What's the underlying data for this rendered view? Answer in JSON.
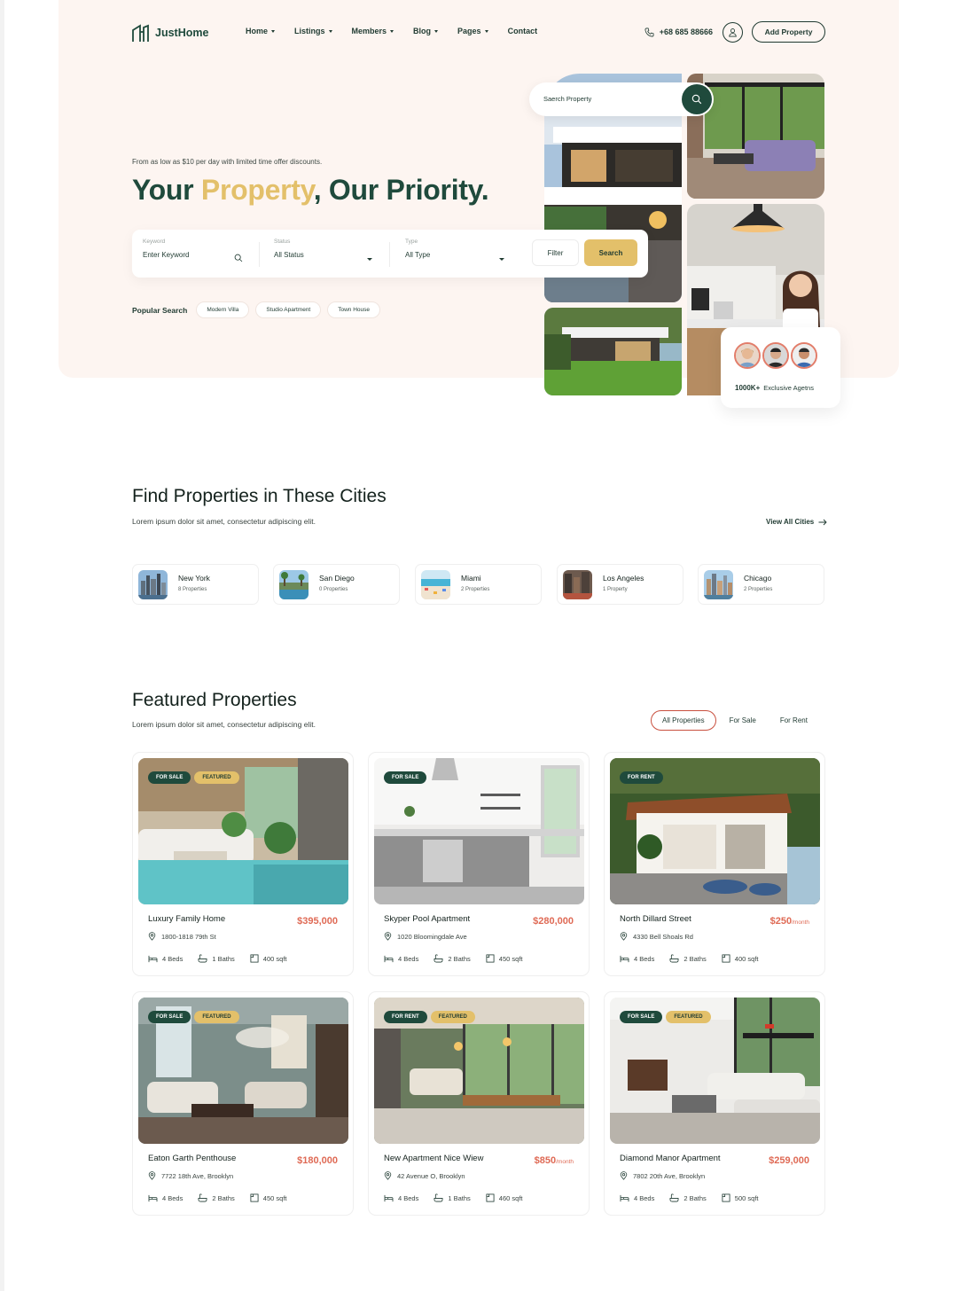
{
  "brand": {
    "name": "JustHome",
    "primary": "#1f4a3c",
    "accent": "#e3c06a",
    "price": "#df6a55",
    "hero_bg": "#fdf5f1"
  },
  "nav": {
    "items": [
      {
        "label": "Home",
        "caret": true
      },
      {
        "label": "Listings",
        "caret": true
      },
      {
        "label": "Members",
        "caret": true
      },
      {
        "label": "Blog",
        "caret": true
      },
      {
        "label": "Pages",
        "caret": true
      },
      {
        "label": "Contact",
        "caret": false
      }
    ],
    "phone": "+68 685 88666",
    "add_property": "Add Property"
  },
  "hero": {
    "subtitle": "From as low as $10 per day with limited time offer discounts.",
    "title_part1": "Your ",
    "title_accent": "Property",
    "title_part2": ", Our Priority.",
    "search": {
      "keyword_label": "Keyword",
      "keyword_value": "Enter Keyword",
      "status_label": "Status",
      "status_value": "All Status",
      "type_label": "Type",
      "type_value": "All Type",
      "filter": "Filter",
      "search": "Search"
    },
    "popular_label": "Popular Search",
    "popular_tags": [
      "Modern Villa",
      "Studio Apartment",
      "Town House"
    ],
    "search_property_placeholder": "Saerch Property",
    "agents_count": "1000K+",
    "agents_label": "Exclusive Agetns"
  },
  "cities": {
    "title": "Find Properties in These Cities",
    "subtitle": "Lorem ipsum dolor sit amet, consectetur adipiscing elit.",
    "view_all": "View All Cities",
    "items": [
      {
        "name": "New York",
        "count": "8 Properties"
      },
      {
        "name": "San Diego",
        "count": "0 Properties"
      },
      {
        "name": "Miami",
        "count": "2 Properties"
      },
      {
        "name": "Los Angeles",
        "count": "1 Property"
      },
      {
        "name": "Chicago",
        "count": "2 Properties"
      }
    ]
  },
  "featured": {
    "title": "Featured Properties",
    "subtitle": "Lorem ipsum dolor sit amet, consectetur adipiscing elit.",
    "tabs": [
      "All Properties",
      "For Sale",
      "For Rent"
    ],
    "active_tab": "All Properties",
    "properties": [
      {
        "status": "FOR SALE",
        "featured": "FEATURED",
        "title": "Luxury Family Home",
        "price": "$395,000",
        "unit": "",
        "address": "1800-1818 79th St",
        "beds": "4 Beds",
        "baths": "1 Baths",
        "area": "400 sqft"
      },
      {
        "status": "FOR SALE",
        "featured": "",
        "title": "Skyper Pool Apartment",
        "price": "$280,000",
        "unit": "",
        "address": "1020 Bloomingdale Ave",
        "beds": "4 Beds",
        "baths": "2 Baths",
        "area": "450 sqft"
      },
      {
        "status": "FOR RENT",
        "featured": "",
        "title": "North Dillard Street",
        "price": "$250",
        "unit": "/month",
        "address": "4330 Bell Shoals Rd",
        "beds": "4 Beds",
        "baths": "2 Baths",
        "area": "400 sqft"
      },
      {
        "status": "FOR SALE",
        "featured": "FEATURED",
        "title": "Eaton Garth Penthouse",
        "price": "$180,000",
        "unit": "",
        "address": "7722 18th Ave, Brooklyn",
        "beds": "4 Beds",
        "baths": "2 Baths",
        "area": "450 sqft"
      },
      {
        "status": "FOR RENT",
        "featured": "FEATURED",
        "title": "New Apartment Nice Wiew",
        "price": "$850",
        "unit": "/month",
        "address": "42 Avenue O, Brooklyn",
        "beds": "4 Beds",
        "baths": "1 Baths",
        "area": "460 sqft"
      },
      {
        "status": "FOR SALE",
        "featured": "FEATURED",
        "title": "Diamond Manor Apartment",
        "price": "$259,000",
        "unit": "",
        "address": "7802 20th Ave, Brooklyn",
        "beds": "4 Beds",
        "baths": "2 Baths",
        "area": "500 sqft"
      }
    ]
  }
}
